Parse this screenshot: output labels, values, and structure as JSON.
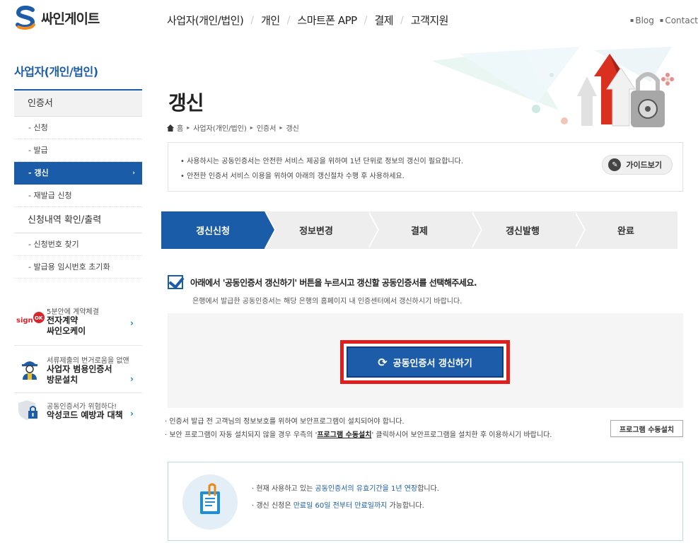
{
  "header": {
    "logo_text": "싸인게이트",
    "nav": [
      "사업자(개인/법인)",
      "개인",
      "스마트폰 APP",
      "결제",
      "고객지원"
    ],
    "util": [
      "Blog",
      "Contact"
    ]
  },
  "sidebar": {
    "title": "사업자(개인/법인)",
    "group1": "인증서",
    "items1": [
      "- 신청",
      "- 발급",
      "- 갱신",
      "- 재발급 신청"
    ],
    "group2": "신청내역 확인/출력",
    "items2": [
      "- 신청번호 찾기",
      "- 발급용 임시번호 초기화"
    ],
    "active_arrow": "›"
  },
  "banners": [
    {
      "sub": "5분안에 계약체결",
      "main1": "전자계약",
      "main2": "싸인오케이",
      "icon": "signok-logo"
    },
    {
      "sub": "서류제출의 번거로움을 없앤",
      "main1": "사업자 범용인증서",
      "main2": "방문설치",
      "icon": "visit-worker-icon"
    },
    {
      "sub": "공동인증서가 위험하다!",
      "main1": "악성코드 예방과 대책",
      "main2": "",
      "icon": "shield-lock-icon"
    }
  ],
  "page": {
    "title": "갱신",
    "breadcrumb": [
      "홈",
      "사업자(개인/법인)",
      "인증서",
      "갱신"
    ]
  },
  "notice": {
    "lines": [
      "사용하시는 공동인증서는 안전한 서비스 제공을 위하여 1년 단위로 정보의 갱신이 필요합니다.",
      "안전한 인증서 서비스 이용을 위하여 아래의 갱신절차 수행 후 사용하세요."
    ],
    "guide_label": "가이드보기"
  },
  "steps": [
    "갱신신청",
    "정보변경",
    "결제",
    "갱신발행",
    "완료"
  ],
  "active_step": 0,
  "instruction": {
    "main": "아래에서 '공동인증서 갱신하기' 버튼을 누르시고 갱신할 공동인증서를 선택해주세요.",
    "sub": "은행에서 발급한 공동인증서는 해당 은행의 홈페이지 내 인증센터에서 갱신하시기 바랍니다."
  },
  "renew_button": "공동인증서 갱신하기",
  "security": {
    "line1": "인증서 발급 전 고객님의 정보보호를 위하여 보안프로그램이 설치되어야 합니다.",
    "line2_a": "보안 프로그램이 자동 설치되지 않을 경우 우측의 '",
    "line2_link": "프로그램 수동설치",
    "line2_b": "' 클릭하시어 보안프로그램을 설치한 후 이용하시기 바랍니다.",
    "manual_button": "프로그램 수동설치"
  },
  "info": {
    "l1_a": "현재 사용하고 있는 ",
    "l1_hl": "공동인증서의 유효기간을 1년 연장",
    "l1_b": "합니다.",
    "l2_a": "갱신 신청은 ",
    "l2_hl": "만료일 60일 전부터 만료일까지",
    "l2_b": " 가능합니다."
  },
  "colors": {
    "accent": "#1a5ca8",
    "highlight_border": "#e01e1e"
  }
}
